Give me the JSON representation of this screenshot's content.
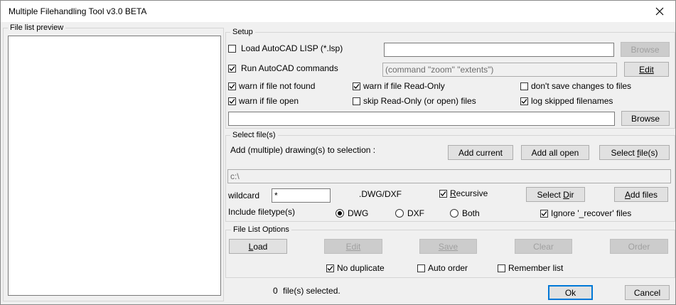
{
  "window": {
    "title": "Multiple Filehandling Tool v3.0 BETA"
  },
  "icons": {
    "close": "close-x-icon",
    "check": "checkmark-icon"
  },
  "colors": {
    "accent": "#0078d7",
    "disabled_text": "#a0a0a0"
  },
  "file_list": {
    "label": "File list preview",
    "items": []
  },
  "setup": {
    "label": "Setup",
    "load_lisp": {
      "label": "Load AutoCAD LISP (*.lsp)",
      "checked": false
    },
    "lisp_path": "",
    "browse1": "Browse",
    "run_commands": {
      "label": "Run AutoCAD commands",
      "checked": true
    },
    "commands_value": "(command \"zoom\" \"extents\")",
    "edit": "Edit",
    "warn_not_found": {
      "label": "warn if file not found",
      "checked": true
    },
    "warn_readonly": {
      "label": "warn if file Read-Only",
      "checked": true
    },
    "dont_save": {
      "label": "don't save changes to files",
      "checked": false
    },
    "warn_open": {
      "label": "warn if file open",
      "checked": true
    },
    "skip_readonly": {
      "label": "skip Read-Only (or open) files",
      "checked": false
    },
    "log_skipped": {
      "label": "log skipped filenames",
      "checked": true
    },
    "log_path": "",
    "browse2": "Browse"
  },
  "select": {
    "label": "Select file(s)",
    "add_label": "Add (multiple) drawing(s) to selection :",
    "add_current": "Add current",
    "add_all_open": "Add all open",
    "select_files_pre": "Select ",
    "select_files_u": "f",
    "select_files_post": "ile(s)",
    "path_value": "c:\\",
    "wildcard_label": "wildcard",
    "wildcard_value": "*",
    "ext_label": ".DWG/DXF",
    "recursive_u": "R",
    "recursive_rest": "ecursive",
    "recursive_checked": true,
    "select_dir_pre": "Select ",
    "select_dir_u": "D",
    "select_dir_post": "ir",
    "add_files_u": "A",
    "add_files_rest": "dd files",
    "filetype_label": "Include filetype(s)",
    "radio_dwg": "DWG",
    "radio_dxf": "DXF",
    "radio_both": "Both",
    "selected_type": "DWG",
    "ignore_recover": {
      "label": "Ignore '_recover' files",
      "checked": true
    }
  },
  "options": {
    "label": "File List Options",
    "load_u": "L",
    "load_rest": "oad",
    "edit": "Edit",
    "save": "Save",
    "clear": "Clear",
    "order": "Order",
    "no_duplicate": {
      "label": "No duplicate",
      "checked": true
    },
    "auto_order": {
      "label": "Auto order",
      "checked": false
    },
    "remember_list": {
      "label": "Remember list",
      "checked": false
    }
  },
  "footer": {
    "count": "0",
    "count_label": "file(s) selected.",
    "ok": "Ok",
    "cancel": "Cancel"
  }
}
